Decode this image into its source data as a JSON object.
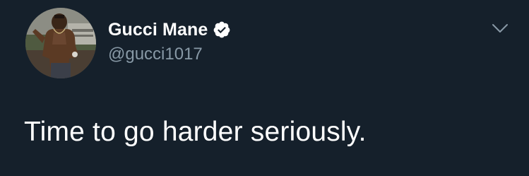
{
  "tweet": {
    "author": {
      "display_name": "Gucci Mane",
      "handle": "@gucci1017",
      "verified": true,
      "avatar_icon": "profile-photo"
    },
    "text": "Time to go harder seriously.",
    "menu_icon": "chevron-down-icon"
  },
  "colors": {
    "background": "#15202b",
    "name": "#ffffff",
    "handle": "#8899a6",
    "text": "#ffffff",
    "caret": "#8899a6",
    "verified_badge": "#ffffff"
  }
}
